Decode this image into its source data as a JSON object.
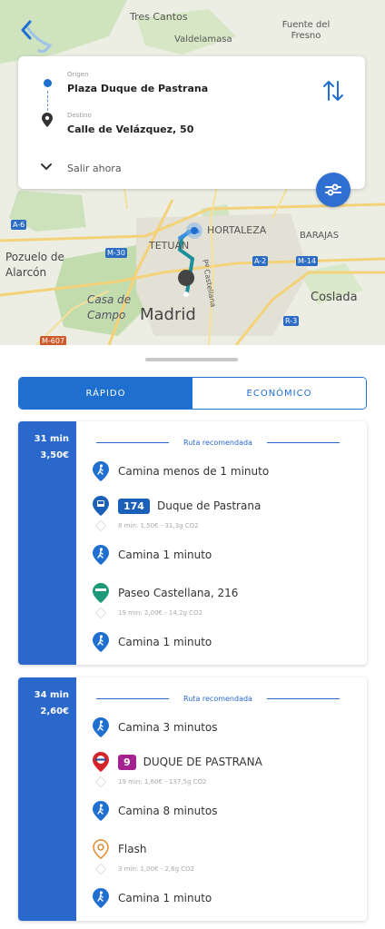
{
  "map": {
    "labels": {
      "tres_cantos": "Tres Cantos",
      "valdelamasa": "Valdelamasa",
      "fuente_del_fresno": "Fuente del Fresno",
      "pozuelo": "Pozuelo de Alarcón",
      "tetuan": "TETUÁN",
      "hortaleza": "HORTALEZA",
      "barajas": "BARAJAS",
      "casa_de_campo": "Casa de Campo",
      "madrid": "Madrid",
      "coslada": "Coslada",
      "castellana": "Pº Castellana"
    },
    "roads": [
      "A-6",
      "M-30",
      "A-2",
      "M-14",
      "R-3",
      "M-607"
    ]
  },
  "route_form": {
    "origin_label": "Origen",
    "origin_value": "Plaza Duque de Pastrana",
    "destination_label": "Destino",
    "destination_value": "Calle de Velázquez, 50",
    "depart": "Salir ahora"
  },
  "tabs": [
    "RÁPIDO",
    "ECONÓMICO"
  ],
  "results": [
    {
      "time": "31 min",
      "price": "3,50€",
      "heading": "Ruta recomendada",
      "steps": [
        {
          "text": "Camina menos de 1 minuto"
        },
        {
          "badge": "174",
          "text": "Duque de Pastrana",
          "detail": "8 min: 1,50€ - 31,3g CO2"
        },
        {
          "text": "Camina 1 minuto"
        },
        {
          "text": "Paseo Castellana, 216",
          "detail": "19 min: 2,00€ - 14,2g CO2"
        },
        {
          "text": "Camina 1 minuto"
        }
      ]
    },
    {
      "time": "34 min",
      "price": "2,60€",
      "heading": "Ruta recomendada",
      "steps": [
        {
          "text": "Camina 3 minutos"
        },
        {
          "badge": "9",
          "text": "DUQUE DE PASTRANA",
          "detail": "19 min: 1,60€ - 137,5g CO2"
        },
        {
          "text": "Camina 8 minutos"
        },
        {
          "text": "Flash",
          "detail": "3 min: 1,00€ - 2,6g CO2"
        },
        {
          "text": "Camina 1 minuto"
        }
      ]
    }
  ],
  "colors": {
    "primary": "#1e6fd0",
    "bus_badge": "#1a5fb8",
    "metro_badge": "#a3228f",
    "metro_red": "#d4242a",
    "bike_green": "#1f9a78",
    "scooter_orange": "#e08a2e"
  }
}
